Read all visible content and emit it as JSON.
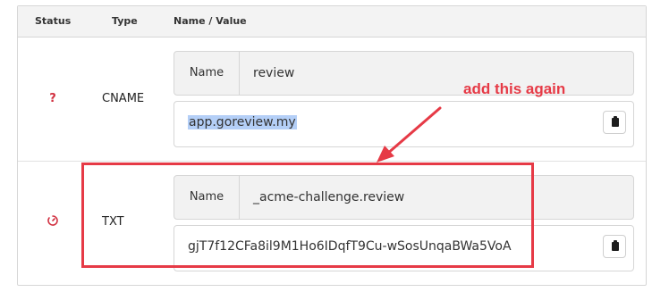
{
  "table": {
    "headers": {
      "status": "Status",
      "type": "Type",
      "name_value": "Name / Value"
    },
    "rows": [
      {
        "status_icon": "question-mark-icon",
        "status_glyph": "?",
        "type": "CNAME",
        "name_label": "Name",
        "name": "review",
        "value": "app.goreview.my",
        "value_selected": true,
        "copy_icon": "clipboard-icon"
      },
      {
        "status_icon": "pending-timer-icon",
        "type": "TXT",
        "name_label": "Name",
        "name": "_acme-challenge.review",
        "value": "gjT7f12CFa8il9M1Ho6IDqfT9Cu-wSosUnqaBWa5VoA",
        "value_selected": false,
        "copy_icon": "clipboard-icon"
      }
    ]
  },
  "annotation": {
    "text": "add this again",
    "color": "#e63a46"
  },
  "colors": {
    "status_red": "#d12f3f",
    "selection_blue": "#b4cff7"
  }
}
